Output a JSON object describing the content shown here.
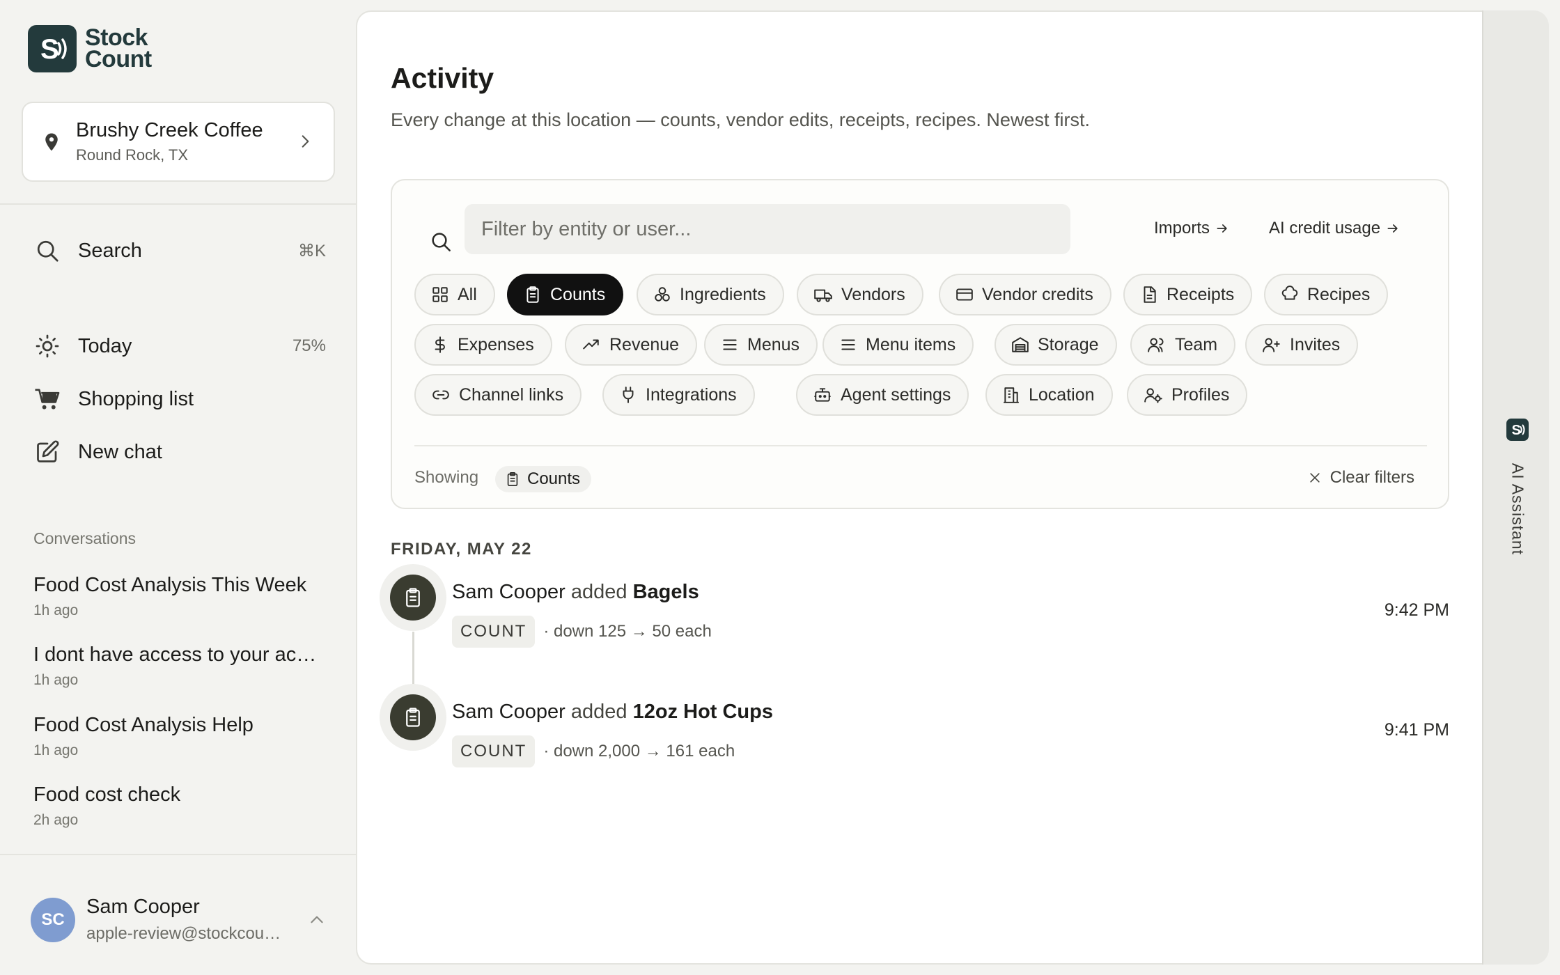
{
  "brand": {
    "line1": "Stock",
    "line2": "Count"
  },
  "location": {
    "name": "Brushy Creek Coffee",
    "city": "Round Rock, TX"
  },
  "nav": {
    "search": {
      "label": "Search",
      "shortcut": "⌘K"
    },
    "today": {
      "label": "Today",
      "progress": "75%"
    },
    "shopping": {
      "label": "Shopping list"
    },
    "new_chat": {
      "label": "New chat"
    }
  },
  "conversations": {
    "heading": "Conversations",
    "items": [
      {
        "title": "Food Cost Analysis This Week",
        "time": "1h ago"
      },
      {
        "title": "I dont have access to your account",
        "time": "1h ago"
      },
      {
        "title": "Food Cost Analysis Help",
        "time": "1h ago"
      },
      {
        "title": "Food cost check",
        "time": "2h ago"
      }
    ]
  },
  "user": {
    "initials": "SC",
    "name": "Sam Cooper",
    "email": "apple-review@stockcount.app"
  },
  "page": {
    "title": "Activity",
    "subtitle": "Every change at this location — counts, vendor edits, receipts, recipes. Newest first."
  },
  "filter": {
    "placeholder": "Filter by entity or user...",
    "imports_link": "Imports",
    "ai_credit_link": "AI credit usage",
    "chips": [
      {
        "label": "All",
        "icon": "grid-icon",
        "active": false
      },
      {
        "label": "Counts",
        "icon": "clipboard-icon",
        "active": true
      },
      {
        "label": "Ingredients",
        "icon": "ingredients-icon",
        "active": false
      },
      {
        "label": "Vendors",
        "icon": "truck-icon",
        "active": false
      },
      {
        "label": "Vendor credits",
        "icon": "credit-card-icon",
        "active": false
      },
      {
        "label": "Receipts",
        "icon": "receipt-icon",
        "active": false
      },
      {
        "label": "Recipes",
        "icon": "chef-hat-icon",
        "active": false
      },
      {
        "label": "Expenses",
        "icon": "dollar-icon",
        "active": false
      },
      {
        "label": "Revenue",
        "icon": "trending-up-icon",
        "active": false
      },
      {
        "label": "Menus",
        "icon": "list-icon",
        "active": false
      },
      {
        "label": "Menu items",
        "icon": "list-icon",
        "active": false
      },
      {
        "label": "Storage",
        "icon": "warehouse-icon",
        "active": false
      },
      {
        "label": "Team",
        "icon": "users-icon",
        "active": false
      },
      {
        "label": "Invites",
        "icon": "user-plus-icon",
        "active": false
      },
      {
        "label": "Channel links",
        "icon": "link-icon",
        "active": false
      },
      {
        "label": "Integrations",
        "icon": "plug-icon",
        "active": false
      },
      {
        "label": "Agent settings",
        "icon": "bot-icon",
        "active": false
      },
      {
        "label": "Location",
        "icon": "building-icon",
        "active": false
      },
      {
        "label": "Profiles",
        "icon": "user-cog-icon",
        "active": false
      }
    ],
    "showing_label": "Showing",
    "showing_value": "Counts",
    "clear_label": "Clear filters"
  },
  "activity": {
    "date_heading": "FRIDAY, MAY 22",
    "items": [
      {
        "user": "Sam Cooper",
        "verb": "added",
        "entity": "Bagels",
        "badge": "COUNT",
        "detail": "· down 125 → 50 each",
        "time": "9:42 PM"
      },
      {
        "user": "Sam Cooper",
        "verb": "added",
        "entity": "12oz Hot Cups",
        "badge": "COUNT",
        "detail": "· down 2,000 → 161 each",
        "time": "9:41 PM"
      }
    ]
  },
  "assistant": {
    "label": "AI Assistant"
  },
  "colors": {
    "brand": "#233a3c",
    "active_chip": "#111111",
    "avatar": "#7f9cd0",
    "activity_icon": "#3a3c30"
  }
}
